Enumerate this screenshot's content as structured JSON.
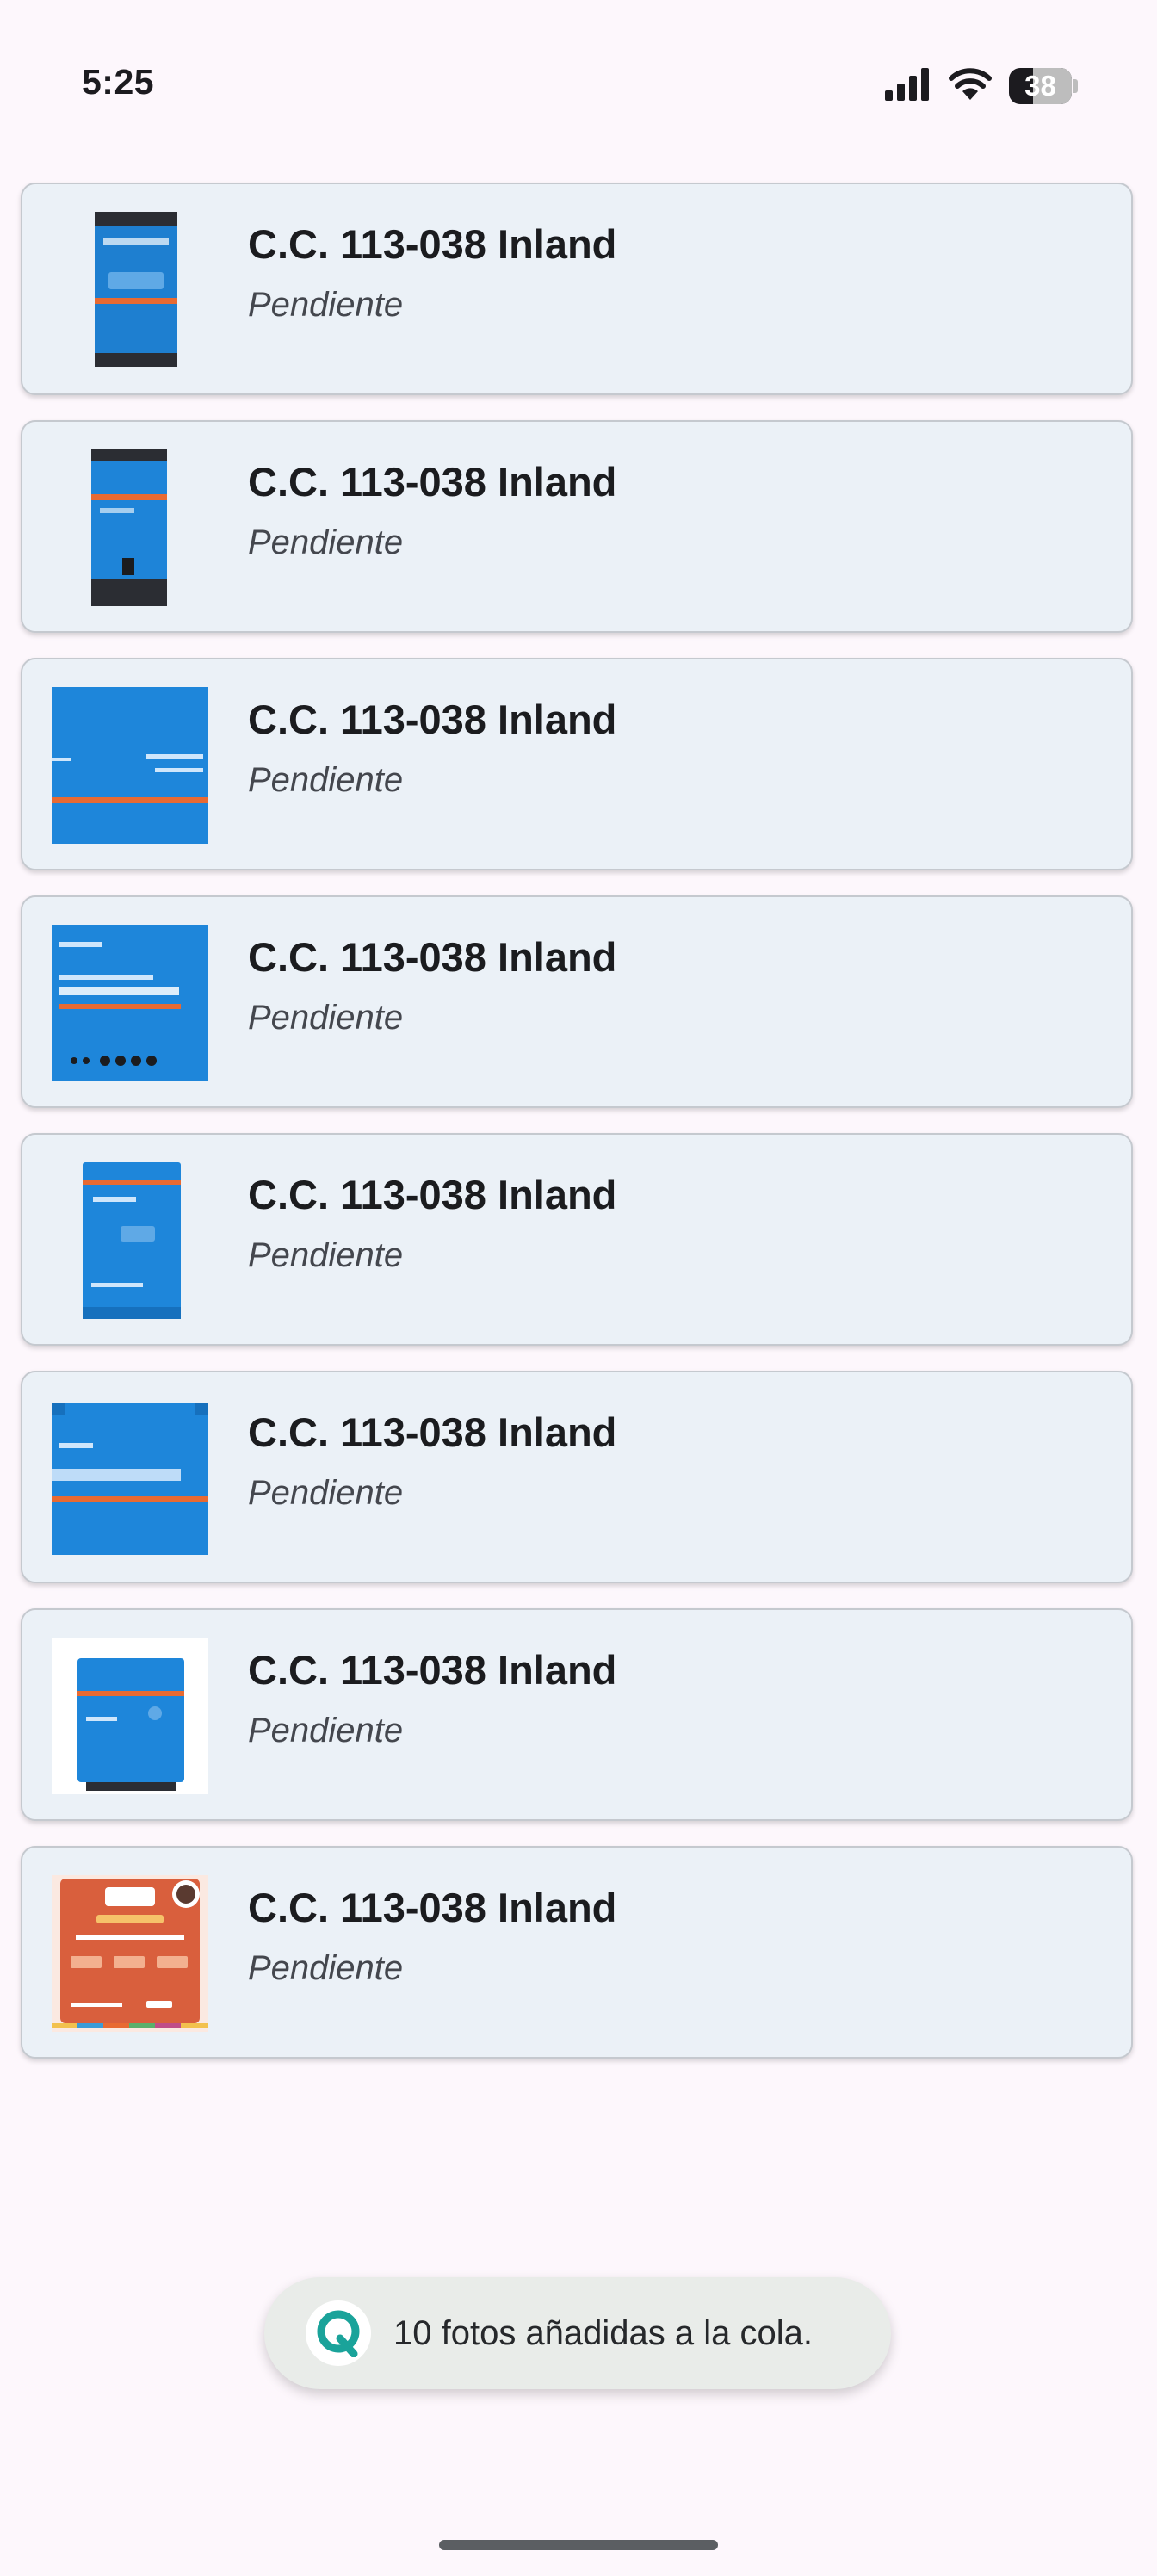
{
  "status_bar": {
    "time": "5:25",
    "battery_level": "38",
    "battery_fraction": 0.38,
    "icons": [
      "signal-icon",
      "wifi-icon",
      "battery-icon"
    ]
  },
  "items": [
    {
      "title": "C.C. 113-038 Inland",
      "status": "Pendiente",
      "thumb": "blue-charger-front"
    },
    {
      "title": "C.C. 113-038 Inland",
      "status": "Pendiente",
      "thumb": "blue-charger-tall"
    },
    {
      "title": "C.C. 113-038 Inland",
      "status": "Pendiente",
      "thumb": "blue-inverter-wide"
    },
    {
      "title": "C.C. 113-038 Inland",
      "status": "Pendiente",
      "thumb": "blue-dc-converter"
    },
    {
      "title": "C.C. 113-038 Inland",
      "status": "Pendiente",
      "thumb": "blue-inverter-compact"
    },
    {
      "title": "C.C. 113-038 Inland",
      "status": "Pendiente",
      "thumb": "blue-inverter-flat"
    },
    {
      "title": "C.C. 113-038 Inland",
      "status": "Pendiente",
      "thumb": "blue-multiplus"
    },
    {
      "title": "C.C. 113-038 Inland",
      "status": "Pendiente",
      "thumb": "orange-zoom-flyer"
    }
  ],
  "snackbar": {
    "message": "10 fotos añadidas a la cola.",
    "icon": "q-logo-icon"
  },
  "colors": {
    "background": "#fdf7fc",
    "card": "#ebf1f7",
    "device_blue": "#1a7fd6",
    "device_orange": "#e86a32",
    "flyer_orange": "#d95f3d"
  }
}
